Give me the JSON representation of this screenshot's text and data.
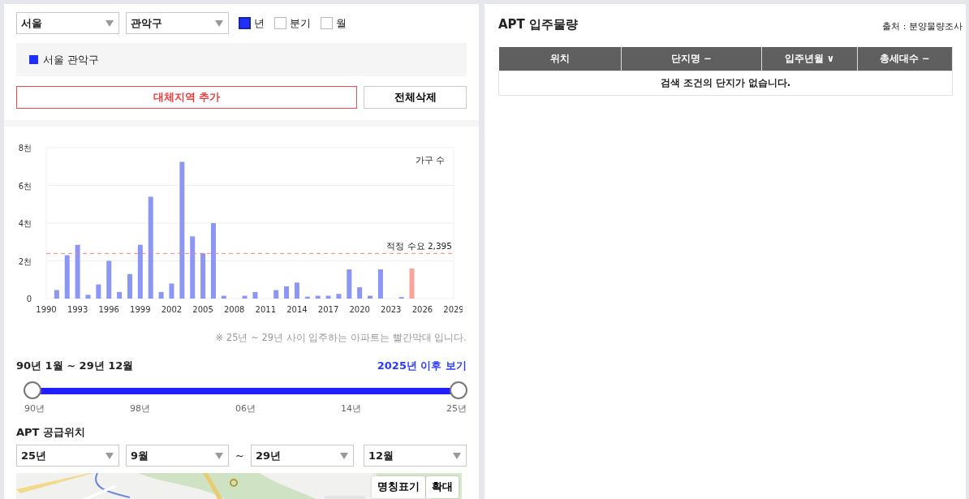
{
  "filters": {
    "selects": [
      {
        "value": "서울"
      },
      {
        "value": "관악구"
      }
    ],
    "periods": [
      {
        "label": "년",
        "checked": true
      },
      {
        "label": "분기",
        "checked": false
      },
      {
        "label": "월",
        "checked": false
      }
    ]
  },
  "legend": [
    {
      "label": "서울 관악구",
      "color": "#1f2fff"
    }
  ],
  "buttons": [
    {
      "label": "대체지역 추가",
      "kind": "primary"
    },
    {
      "label": "전체삭제",
      "kind": "plain"
    }
  ],
  "chart": {
    "chart_data": {
      "type": "bar",
      "stacked": true,
      "ylabel": "가구 수",
      "categories": [
        "1990",
        null,
        null,
        "1993",
        null,
        null,
        "1996",
        null,
        null,
        "1999",
        null,
        null,
        "2002",
        null,
        null,
        "2005",
        null,
        null,
        "2008",
        null,
        null,
        "2011",
        null,
        null,
        "2014",
        null,
        null,
        "2017",
        null,
        null,
        "2020",
        null,
        null,
        "2023",
        null,
        null,
        "2026",
        null,
        null,
        "2029"
      ],
      "series": [
        {
          "color": "#8c96f5",
          "values": [
            0,
            0.45,
            2.3,
            2.85,
            0.2,
            0.75,
            2,
            0.35,
            1.3,
            2.85,
            5.4,
            0.35,
            0.8,
            7.25,
            3.3,
            2.4,
            4,
            0.15,
            0,
            0.15,
            0.35,
            0,
            0.45,
            0.65,
            0.85,
            0.1,
            0.15,
            0.15,
            0.25,
            1.55,
            0.6,
            0.15,
            1.55,
            0,
            0.08,
            null,
            null,
            null,
            null,
            null
          ]
        },
        {
          "color": "#f7a59b",
          "values": [
            null,
            null,
            null,
            null,
            null,
            null,
            null,
            null,
            null,
            null,
            null,
            null,
            null,
            null,
            null,
            null,
            null,
            null,
            null,
            null,
            null,
            null,
            null,
            null,
            null,
            null,
            null,
            null,
            null,
            null,
            null,
            null,
            null,
            null,
            null,
            1.6,
            0,
            0,
            0,
            0
          ]
        }
      ],
      "ylim": [
        0,
        8
      ],
      "yticks": [
        {
          "value": 0,
          "label": "0"
        },
        {
          "value": 2,
          "label": "2천"
        },
        {
          "value": 4,
          "label": "4천"
        },
        {
          "value": 6,
          "label": "6천"
        },
        {
          "value": 8,
          "label": "8천"
        }
      ],
      "grid": true,
      "ref_lines": [
        {
          "axis": "y",
          "value": 2.395,
          "label": "적정 수요 2,395",
          "color": "#f08080"
        }
      ]
    },
    "note": "※ 25년 ~ 29년 사이 입주하는 아파트는 빨간막대 입니다."
  },
  "range": {
    "label": "90년 1월 ~ 29년 12월",
    "link": "2025년 이후 보기",
    "level": 1,
    "ticks": [
      "90년",
      "98년",
      "06년",
      "14년",
      "25년"
    ]
  },
  "supply": {
    "title": "APT 공급위치",
    "from": [
      {
        "value": "25년"
      },
      {
        "value": "9월"
      }
    ],
    "separator": "~",
    "to": [
      {
        "value": "29년"
      },
      {
        "value": "12월"
      }
    ],
    "map_buttons": [
      "명칭표기",
      "확대"
    ]
  },
  "occupancy": {
    "title": "APT 입주물량",
    "source": "출처 : 분양물량조사",
    "columns": [
      {
        "label": "위치"
      },
      {
        "label": "단지명",
        "sort_icon": "−"
      },
      {
        "label": "입주년월",
        "sort_icon": "∨"
      },
      {
        "label": "총세대수",
        "sort_icon": "−"
      }
    ],
    "empty_message": "검색 조건의 단지가 없습니다."
  }
}
